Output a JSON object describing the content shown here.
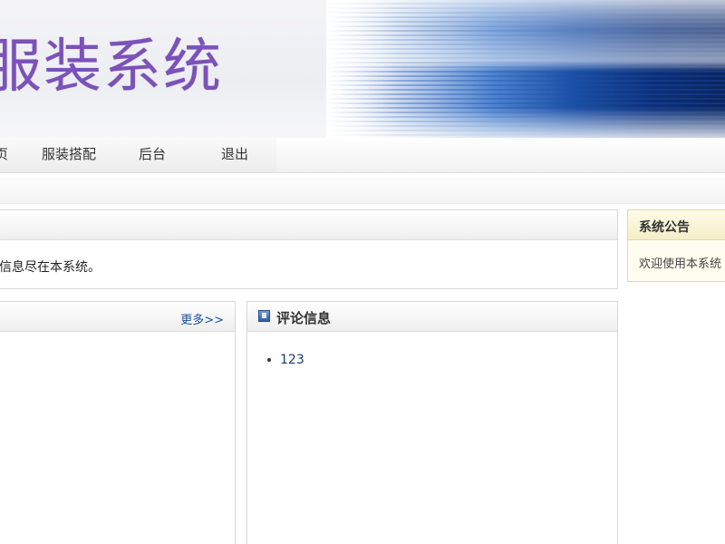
{
  "header": {
    "site_title": "服装系统"
  },
  "nav": {
    "items": [
      {
        "label": "页"
      },
      {
        "label": "服装搭配"
      },
      {
        "label": "后台"
      },
      {
        "label": "退出"
      }
    ]
  },
  "welcome": {
    "text": "信息尽在本系统。"
  },
  "notice": {
    "title": "系统公告",
    "text": "欢迎使用本系统"
  },
  "left_panel": {
    "more_label": "更多>>"
  },
  "comments": {
    "title": "评论信息",
    "items": [
      "123"
    ]
  }
}
